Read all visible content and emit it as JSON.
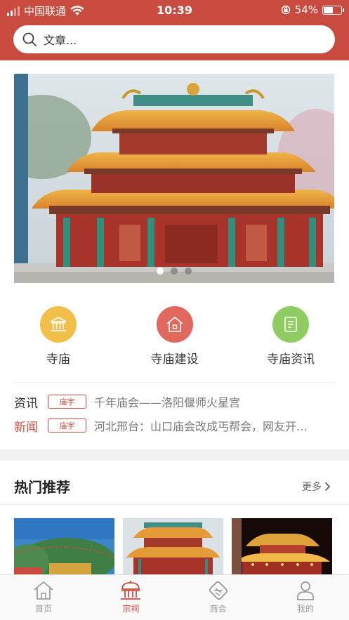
{
  "status_bar": {
    "carrier": "中国联通",
    "time": "10:39",
    "battery": "54%",
    "battery_level": 0.54
  },
  "search": {
    "placeholder": "文章..."
  },
  "banner": {
    "slide_count": 3,
    "active_slide": 1
  },
  "categories": [
    {
      "label": "寺庙",
      "icon": "temple-building-icon",
      "color": "#f2c04a"
    },
    {
      "label": "寺庙建设",
      "icon": "house-icon",
      "color": "#e0685c"
    },
    {
      "label": "寺庙资讯",
      "icon": "document-icon",
      "color": "#8fcd63"
    }
  ],
  "news": [
    {
      "type": "资讯",
      "type_color": "#333333",
      "tag": "庙宇",
      "title": "千年庙会——洛阳偃师火星宫"
    },
    {
      "type": "新闻",
      "type_color": "#c94b3f",
      "tag": "庙宇",
      "title": "河北邢台：山口庙会改成丐帮会，网友开…"
    }
  ],
  "hot": {
    "title": "热门推荐",
    "more": "更多"
  },
  "tabbar": [
    {
      "label": "首页",
      "icon": "home-icon",
      "active": false
    },
    {
      "label": "宗祠",
      "icon": "ancestral-hall-icon",
      "active": true
    },
    {
      "label": "商会",
      "icon": "handshake-icon",
      "active": false
    },
    {
      "label": "我的",
      "icon": "user-icon",
      "active": false
    }
  ],
  "colors": {
    "brand": "#c94b3f",
    "inactive": "#999999"
  }
}
